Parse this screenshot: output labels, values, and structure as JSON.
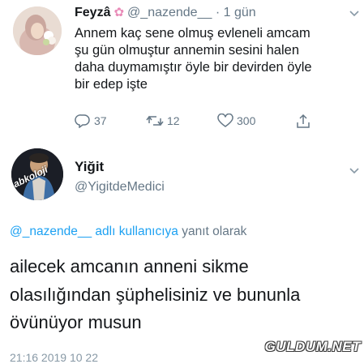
{
  "tweet1": {
    "name": "Feyzâ",
    "name_emoji": "✿",
    "handle": "@_nazende__",
    "time": "· 1 gün",
    "lines": [
      "Annem kaç sene olmuş evleneli amcam",
      "şu gün olmuştur annemin sesini halen",
      "daha duymamıştır öyle bir devirden öyle",
      "bir edep işte"
    ],
    "actions": {
      "replies": "37",
      "retweets": "12",
      "likes": "300"
    }
  },
  "tweet2": {
    "name": "Yiğit",
    "handle": "@YigitdeMedici",
    "avatar_text": "abkoloji",
    "reply_to_handle": "@_nazende__",
    "reply_to_link": "adlı kullanıcıya",
    "reply_to_suffix": "yanıt olarak",
    "lines": [
      "ailecek amcanın anneni sikme",
      "olasılığından şüphelisiniz ve bununla",
      "övünüyor musun"
    ],
    "meta": "21:16  2019  10  22"
  },
  "watermark": "GULDUM.NET",
  "icons": [
    "reply-icon",
    "retweet-icon",
    "like-icon",
    "share-icon",
    "chevron-down-icon"
  ],
  "colors": {
    "link": "#1da1f2",
    "muted": "#657786",
    "text": "#14171a"
  }
}
